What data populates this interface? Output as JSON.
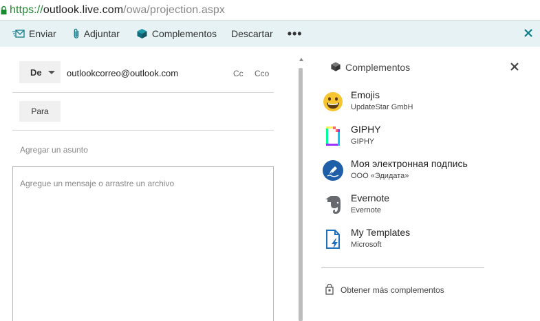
{
  "browser": {
    "url_scheme": "https://",
    "url_host": "outlook.live.com",
    "url_path": "/owa/projection.aspx"
  },
  "toolbar": {
    "send_label": "Enviar",
    "attach_label": "Adjuntar",
    "addins_label": "Complementos",
    "discard_label": "Descartar",
    "more_label": "•••"
  },
  "compose": {
    "from_label": "De",
    "from_email": "outlookcorreo@outlook.com",
    "cc_label": "Cc",
    "bcc_label": "Cco",
    "to_label": "Para",
    "subject_placeholder": "Agregar un asunto",
    "body_placeholder": "Agregue un mensaje o arrastre un archivo"
  },
  "addins_pane": {
    "title": "Complementos",
    "items": [
      {
        "name": "Emojis",
        "publisher": "UpdateStar GmbH",
        "icon": "emoji-smiley-icon"
      },
      {
        "name": "GIPHY",
        "publisher": "GIPHY",
        "icon": "giphy-icon"
      },
      {
        "name": "Моя электронная подпись",
        "publisher": "ООО «Эдидата»",
        "icon": "signature-pen-icon"
      },
      {
        "name": "Evernote",
        "publisher": "Evernote",
        "icon": "evernote-elephant-icon"
      },
      {
        "name": "My Templates",
        "publisher": "Microsoft",
        "icon": "templates-icon"
      }
    ],
    "more_label": "Obtener más complementos"
  },
  "colors": {
    "commandbar_bg": "#e6f2f3",
    "accent_teal": "#0e7b8c",
    "secure_green": "#1a8a2e"
  }
}
